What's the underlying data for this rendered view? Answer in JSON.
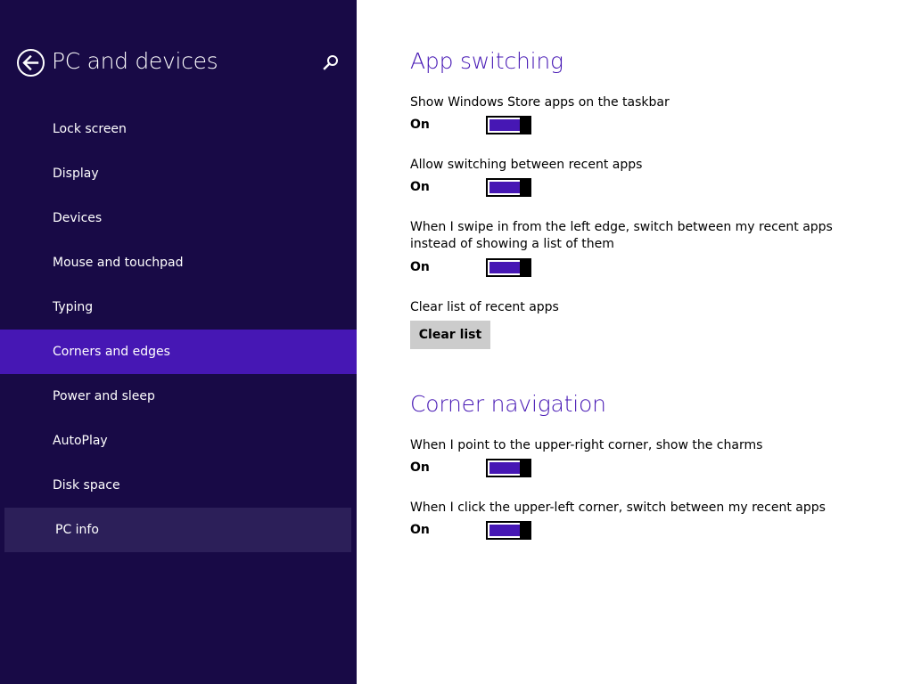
{
  "sidebar": {
    "title": "PC and devices",
    "back_icon": "back-arrow-icon",
    "search_icon": "search-icon",
    "items": [
      {
        "label": "Lock screen"
      },
      {
        "label": "Display"
      },
      {
        "label": "Devices"
      },
      {
        "label": "Mouse and touchpad"
      },
      {
        "label": "Typing"
      },
      {
        "label": "Corners and edges",
        "selected": true
      },
      {
        "label": "Power and sleep"
      },
      {
        "label": "AutoPlay"
      },
      {
        "label": "Disk space"
      },
      {
        "label": "PC info",
        "hovered": true
      }
    ]
  },
  "content": {
    "app_switching": {
      "heading": "App switching",
      "settings": [
        {
          "label": "Show Windows Store apps on the taskbar",
          "state": "On",
          "enabled": true
        },
        {
          "label": "Allow switching between recent apps",
          "state": "On",
          "enabled": true
        },
        {
          "label": "When I swipe in from the left edge, switch between my recent apps instead of showing a list of them",
          "state": "On",
          "enabled": true
        }
      ],
      "clear_list": {
        "label": "Clear list of recent apps",
        "button": "Clear list"
      }
    },
    "corner_navigation": {
      "heading": "Corner navigation",
      "settings": [
        {
          "label": "When I point to the upper-right corner, show the charms",
          "state": "On",
          "enabled": true
        },
        {
          "label": "When I click the upper-left corner, switch between my recent apps",
          "state": "On",
          "enabled": true
        }
      ]
    }
  },
  "colors": {
    "sidebar_bg": "#180a46",
    "accent": "#4617b4",
    "hover_bg": "#2c1f59",
    "button_bg": "#cccccc"
  }
}
